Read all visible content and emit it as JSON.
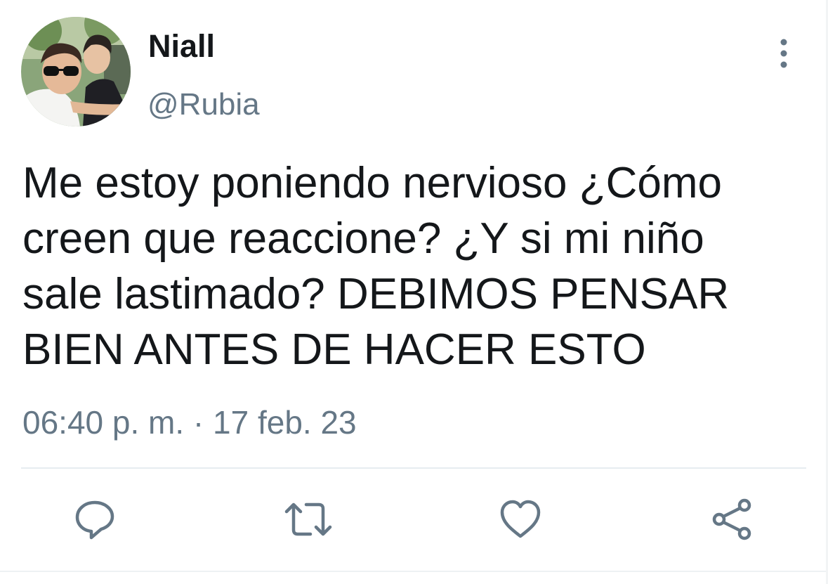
{
  "tweet": {
    "author_name": "Niall",
    "author_handle": "@Rubia",
    "text": "Me estoy poniendo nervioso ¿Cómo\ncreen que reaccione? ¿Y si mi niño\nsale lastimado? DEBIMOS PENSAR\nBIEN ANTES DE HACER ESTO",
    "timestamp": "06:40 p. m. · 17 feb. 23"
  },
  "icons": {
    "more": "more-vertical-icon",
    "reply": "reply-icon",
    "retweet": "retweet-icon",
    "like": "like-icon",
    "share": "share-icon"
  },
  "colors": {
    "text": "#14171a",
    "secondary": "#657786",
    "icon": "#657786",
    "divider": "#e6ecf0"
  }
}
